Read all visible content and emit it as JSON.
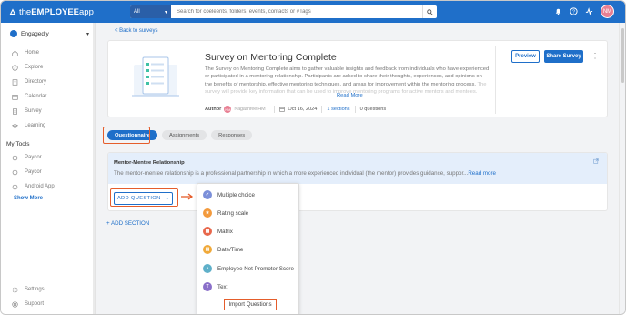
{
  "app": {
    "logo_prefix": "the",
    "logo_bold": "EMPLOYEE",
    "logo_suffix": "app"
  },
  "search": {
    "scope": "All",
    "placeholder": "Search for coeleents, folders, events, contacts or #Tags"
  },
  "user": {
    "initials": "NM",
    "avatar_color": "#e87f93"
  },
  "sidebar": {
    "org": "Engagedly",
    "items": [
      {
        "label": "Home",
        "icon": "home-icon"
      },
      {
        "label": "Explore",
        "icon": "compass-icon"
      },
      {
        "label": "Directory",
        "icon": "directory-icon"
      },
      {
        "label": "Calendar",
        "icon": "calendar-icon"
      },
      {
        "label": "Survey",
        "icon": "survey-icon"
      },
      {
        "label": "Learning",
        "icon": "learning-icon"
      }
    ],
    "my_tools_heading": "My Tools",
    "tools": [
      {
        "label": "Paycor"
      },
      {
        "label": "Paycor"
      },
      {
        "label": "Android App"
      }
    ],
    "show_more": "Show More",
    "bottom": [
      {
        "label": "Settings",
        "icon": "gear-icon"
      },
      {
        "label": "Support",
        "icon": "support-icon"
      }
    ]
  },
  "back_link": "< Back to surveys",
  "survey": {
    "title": "Survey on Mentoring Complete",
    "description": "The Survey on Mentoring Complete aims to gather valuable insights and feedback from individuals who have experienced or participated in a mentoring relationship. Participants are asked to share their thoughts, experiences, and opinions on the benefits of mentorship, effective mentoring techniques, and areas for improvement within the mentoring process.",
    "description_faded": "The survey will provide key information that can be used to improve mentoring programs for active mentors and mentees.",
    "read_more": "Read More",
    "author_label": "Author",
    "author_initials": "NM",
    "author_name": "Nagashree HM",
    "date": "Oct 16, 2024",
    "sections": "1 sections",
    "questions": "0 questions",
    "preview_label": "Preview",
    "share_label": "Share Survey"
  },
  "tabs": [
    {
      "label": "Questionnaire",
      "active": true
    },
    {
      "label": "Assignments",
      "active": false
    },
    {
      "label": "Responses",
      "active": false
    }
  ],
  "section": {
    "title": "Mentor-Mentee Relationship",
    "description": "The mentor-mentee relationship is a professional partnership in which a more experienced individual (the mentor) provides guidance, suppor...",
    "read_more": "Read more",
    "add_question": "ADD QUESTION"
  },
  "add_section": "+ ADD SECTION",
  "question_types": [
    {
      "label": "Multiple choice",
      "icon": "check-circle-icon",
      "color": "#7b8fd9",
      "glyph": "✓"
    },
    {
      "label": "Rating scale",
      "icon": "star-icon",
      "color": "#f39a3d",
      "glyph": "★"
    },
    {
      "label": "Matrix",
      "icon": "matrix-icon",
      "color": "#e8674b",
      "glyph": "▦"
    },
    {
      "label": "Date/Time",
      "icon": "calendar-icon",
      "color": "#f0a93a",
      "glyph": "▤"
    },
    {
      "label": "Employee Net Promoter Score",
      "icon": "enps-icon",
      "color": "#5fb0c9",
      "glyph": "◔"
    },
    {
      "label": "Text",
      "icon": "text-icon",
      "color": "#8a6fc9",
      "glyph": "T"
    }
  ],
  "import_questions": "Import Questions",
  "colors": {
    "primary": "#1f6fc9",
    "highlight": "#e55d2b"
  }
}
